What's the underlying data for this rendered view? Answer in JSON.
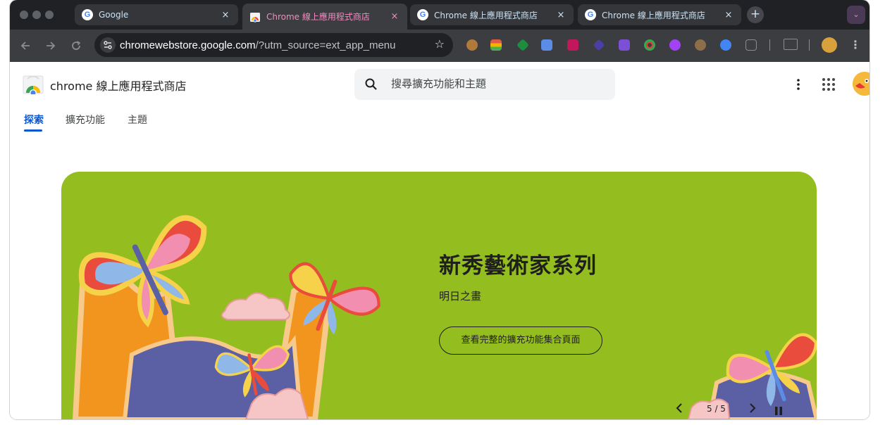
{
  "browser": {
    "tabs": [
      {
        "title": "Google",
        "close": "×",
        "active": false
      },
      {
        "title": "Chrome 線上應用程式商店",
        "close": "×",
        "active": true
      },
      {
        "title": "Chrome 線上應用程式商店",
        "close": "×",
        "active": false
      },
      {
        "title": "Chrome 線上應用程式商店",
        "close": "×",
        "active": false
      }
    ],
    "new_tab": "+",
    "tab_search": "⌄",
    "favicon_letter": "G",
    "address": {
      "host": "chromewebstore.google.com",
      "rest": "/?utm_source=ext_app_menu"
    },
    "colors": {
      "tab_accent": "#f28bc0",
      "tab_text": "#c9e3f5",
      "frame": "#202124",
      "toolbar": "#3c3d41"
    },
    "extension_icons": [
      "cookie-icon",
      "stack-icon",
      "diamond-icon",
      "translate-icon",
      "flower-icon",
      "cube-icon",
      "fox-icon",
      "ring-icon",
      "brain-icon",
      "bear-icon",
      "compass-icon",
      "puzzle-icon"
    ]
  },
  "store": {
    "name": "chrome 線上應用程式商店",
    "search_placeholder": "搜尋擴充功能和主題",
    "nav_tabs": [
      {
        "label": "探索",
        "active": true
      },
      {
        "label": "擴充功能",
        "active": false
      },
      {
        "label": "主題",
        "active": false
      }
    ],
    "accent": "#0b57d0"
  },
  "banner": {
    "title": "新秀藝術家系列",
    "subtitle": "明日之畫",
    "cta": "查看完整的擴充功能集合頁面",
    "counter": "5 / 5",
    "background": "#94bd1f"
  }
}
